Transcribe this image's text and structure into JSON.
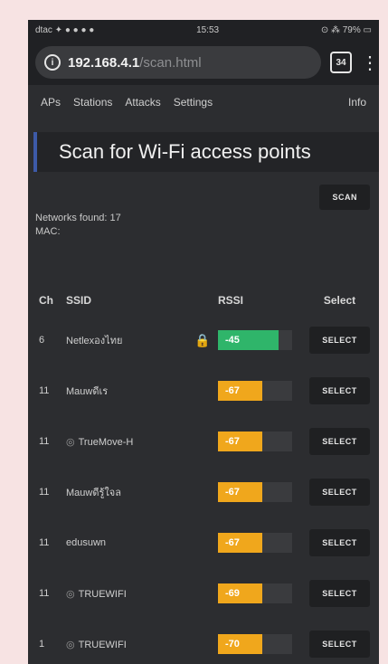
{
  "status_bar": {
    "left": "dtac ✦ ● ● ● ●",
    "time": "15:53",
    "right": "⊙ ⁂ 79% ▭"
  },
  "browser": {
    "url_host": "192.168.4.1",
    "url_path": "/scan.html",
    "tab_count": "34",
    "menu_glyph": "⋮"
  },
  "nav": {
    "items": [
      "APs",
      "Stations",
      "Attacks",
      "Settings"
    ],
    "info": "Info"
  },
  "page": {
    "title": "Scan for Wi-Fi access points",
    "scan_label": "SCAN",
    "networks_found": "Networks found: 17",
    "mac_label": "MAC:"
  },
  "table": {
    "headers": {
      "ch": "Ch",
      "ssid": "SSID",
      "rssi": "RSSI",
      "select": "Select"
    },
    "rows": [
      {
        "ch": "6",
        "ssid": "Netlexองไทย",
        "locked": true,
        "hidden": false,
        "rssi": "-45",
        "level": 0.82,
        "color": "#2fb56a",
        "select": "SELECT"
      },
      {
        "ch": "11",
        "ssid": "Mauwดีเร",
        "locked": false,
        "hidden": false,
        "rssi": "-67",
        "level": 0.6,
        "color": "#f0a71c",
        "select": "SELECT"
      },
      {
        "ch": "11",
        "ssid": "TrueMove-H",
        "locked": false,
        "hidden": true,
        "rssi": "-67",
        "level": 0.6,
        "color": "#f0a71c",
        "select": "SELECT"
      },
      {
        "ch": "11",
        "ssid": "Mauwดีรู้ใจล",
        "locked": false,
        "hidden": false,
        "rssi": "-67",
        "level": 0.6,
        "color": "#f0a71c",
        "select": "SELECT"
      },
      {
        "ch": "11",
        "ssid": "edusuwn",
        "locked": false,
        "hidden": false,
        "rssi": "-67",
        "level": 0.6,
        "color": "#f0a71c",
        "select": "SELECT"
      },
      {
        "ch": "11",
        "ssid": "TRUEWIFI",
        "locked": false,
        "hidden": true,
        "rssi": "-69",
        "level": 0.6,
        "color": "#f0a71c",
        "select": "SELECT"
      },
      {
        "ch": "1",
        "ssid": "TRUEWIFI",
        "locked": false,
        "hidden": true,
        "rssi": "-70",
        "level": 0.6,
        "color": "#f0a71c",
        "select": "SELECT"
      }
    ]
  }
}
